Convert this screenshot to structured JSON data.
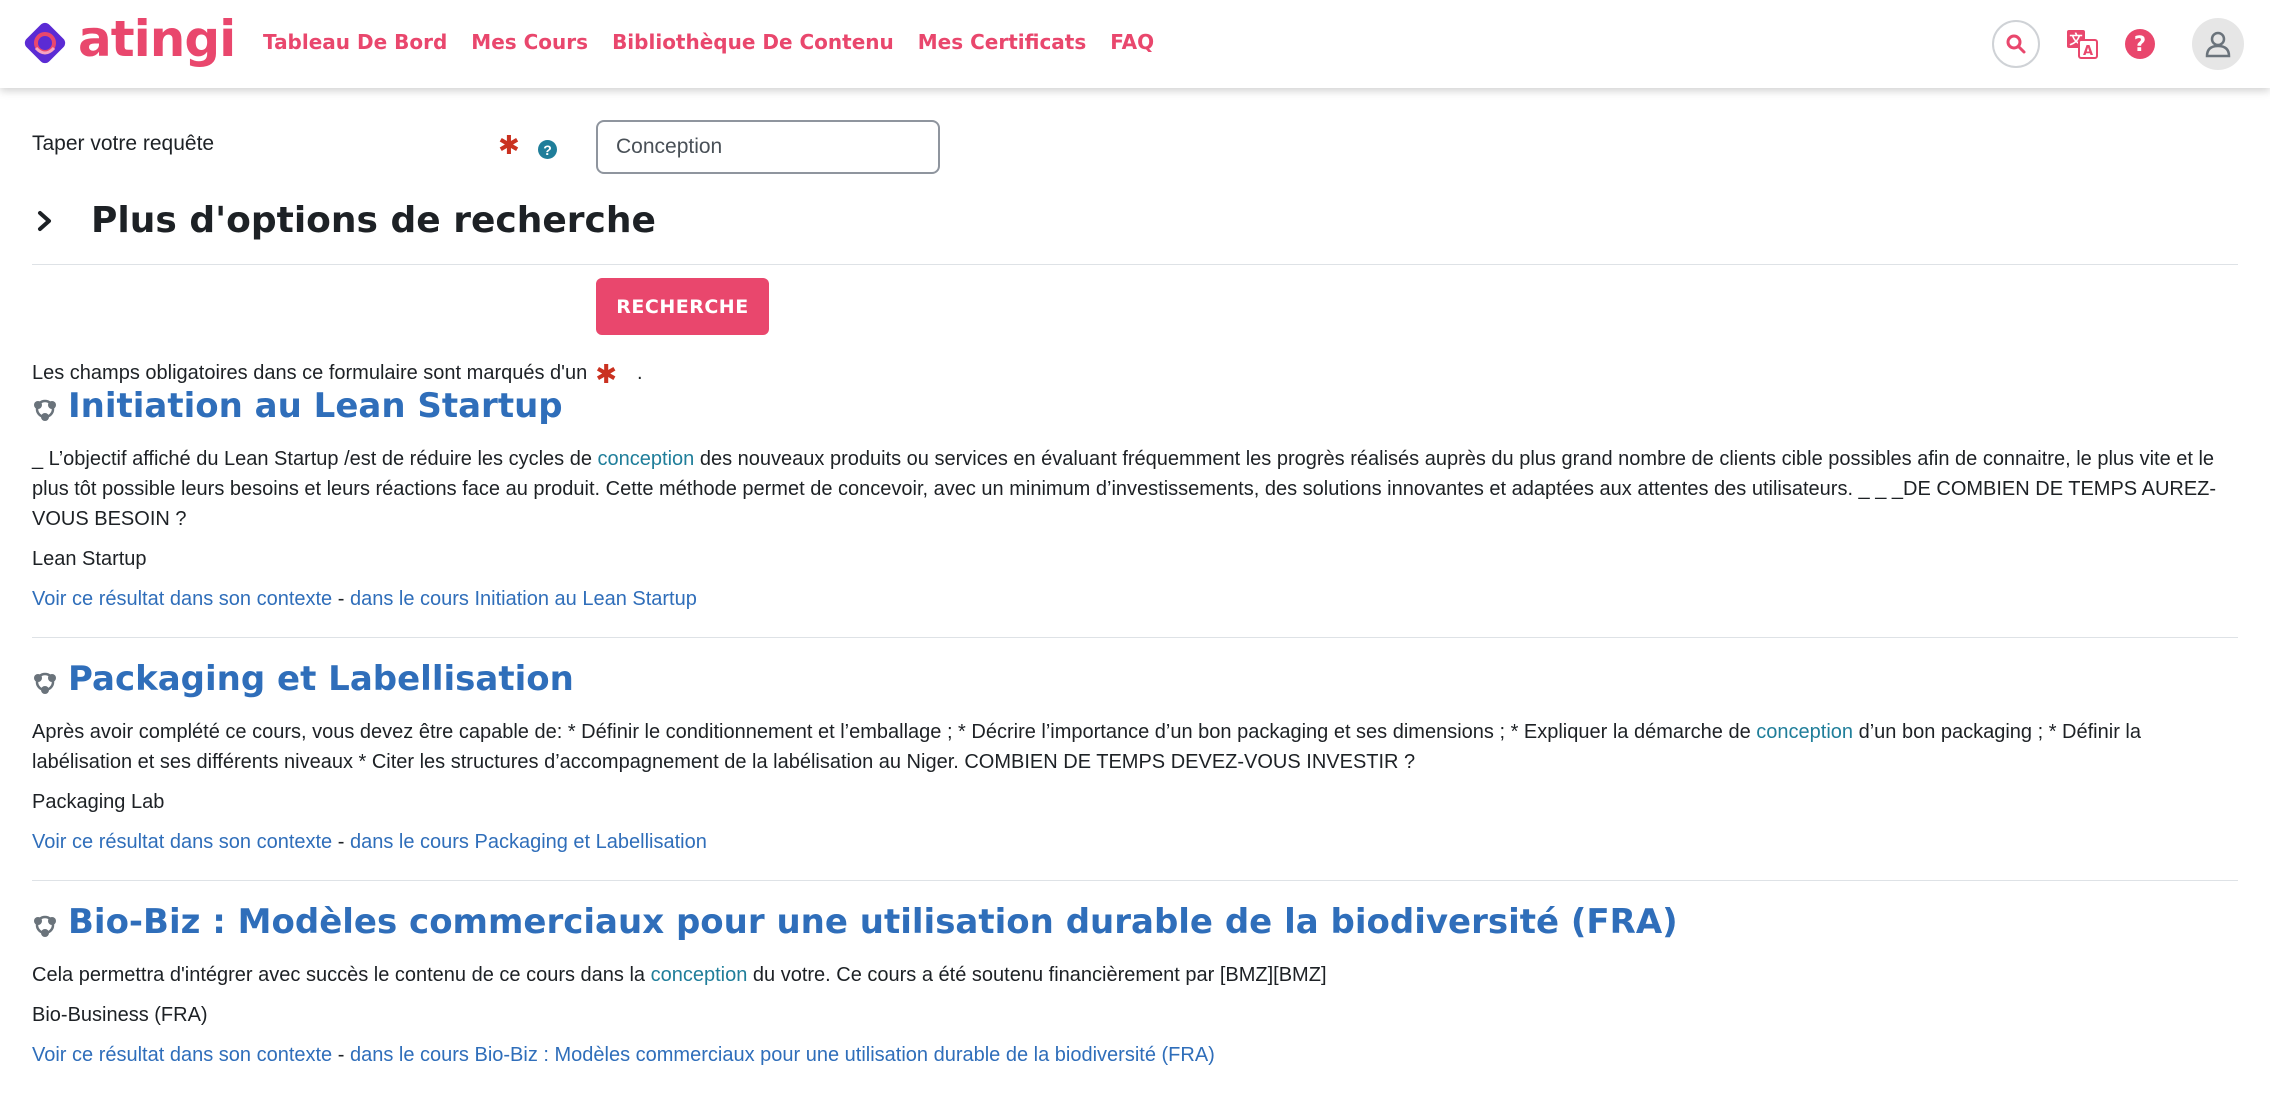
{
  "brand": {
    "name": "atingi",
    "color": "#e9476d"
  },
  "nav": {
    "links": [
      "Tableau De Bord",
      "Mes Cours",
      "Bibliothèque De Contenu",
      "Mes Certificats",
      "FAQ"
    ]
  },
  "icons": {
    "search": "search-icon",
    "translate": "translate-icon",
    "help": "help-icon",
    "avatar": "user-avatar-icon"
  },
  "form": {
    "query_label": "Taper votre requête",
    "query_value": "Conception",
    "required_marker": "✱",
    "help_marker": "?",
    "more_options_title": "Plus d'options de recherche",
    "submit_label": "RECHERCHE",
    "required_note": "Les champs obligatoires dans ce formulaire sont marqués d'un",
    "required_note_end": "."
  },
  "results": [
    {
      "title": "Initiation au Lean Startup",
      "desc_before": "_ L’objectif affiché du Lean Startup /est de réduire les cycles de ",
      "highlight": "conception",
      "desc_after": " des nouveaux produits ou services en évaluant fréquemment les progrès réalisés auprès du plus grand nombre de clients cible possibles afin de connaitre, le plus vite et le plus tôt possible leurs besoins et leurs réactions face au produit. Cette méthode permet de concevoir, avec un minimum d’investissements, des solutions innovantes et adaptées aux attentes des utilisateurs. _ _ _DE COMBIEN DE TEMPS AUREZ-VOUS BESOIN ?",
      "course": "Lean Startup",
      "context_link": "Voir ce résultat dans son contexte",
      "separator": " - ",
      "course_link": "dans le cours Initiation au Lean Startup"
    },
    {
      "title": "Packaging et Labellisation",
      "desc_before": "Après avoir complété ce cours, vous devez être capable de: * Définir le conditionnement et l’emballage ; * Décrire l’importance d’un bon packaging et ses dimensions ; * Expliquer la démarche de ",
      "highlight": "conception",
      "desc_after": " d’un bon packaging ; * Définir la labélisation et ses différents niveaux * Citer les structures d’accompagnement de la labélisation au Niger. COMBIEN DE TEMPS DEVEZ-VOUS INVESTIR ?",
      "course": "Packaging Lab",
      "context_link": "Voir ce résultat dans son contexte",
      "separator": " - ",
      "course_link": "dans le cours Packaging et Labellisation"
    },
    {
      "title": "Bio-Biz : Modèles commerciaux pour une utilisation durable de la biodiversité (FRA)",
      "desc_before": "Cela permettra d'intégrer avec succès le contenu de ce cours dans la ",
      "highlight": "conception",
      "desc_after": " du votre. Ce cours a été soutenu financièrement par [BMZ][BMZ]",
      "course": "Bio-Business (FRA)",
      "context_link": "Voir ce résultat dans son contexte",
      "separator": " - ",
      "course_link": "dans le cours Bio-Biz : Modèles commerciaux pour une utilisation durable de la biodiversité (FRA)"
    }
  ]
}
